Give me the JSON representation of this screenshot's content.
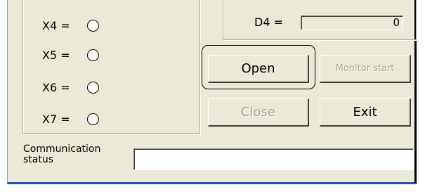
{
  "inputs": [
    {
      "label": "X4 ="
    },
    {
      "label": "X5 ="
    },
    {
      "label": "X6 ="
    },
    {
      "label": "X7 ="
    }
  ],
  "registers": {
    "d4_label": "D4 =",
    "d4_value": "0"
  },
  "buttons": {
    "open": "Open",
    "monitor_start": "Monitor start",
    "close": "Close",
    "exit": "Exit"
  },
  "communication": {
    "label_line1": "Communication",
    "label_line2": "status",
    "value": ""
  }
}
